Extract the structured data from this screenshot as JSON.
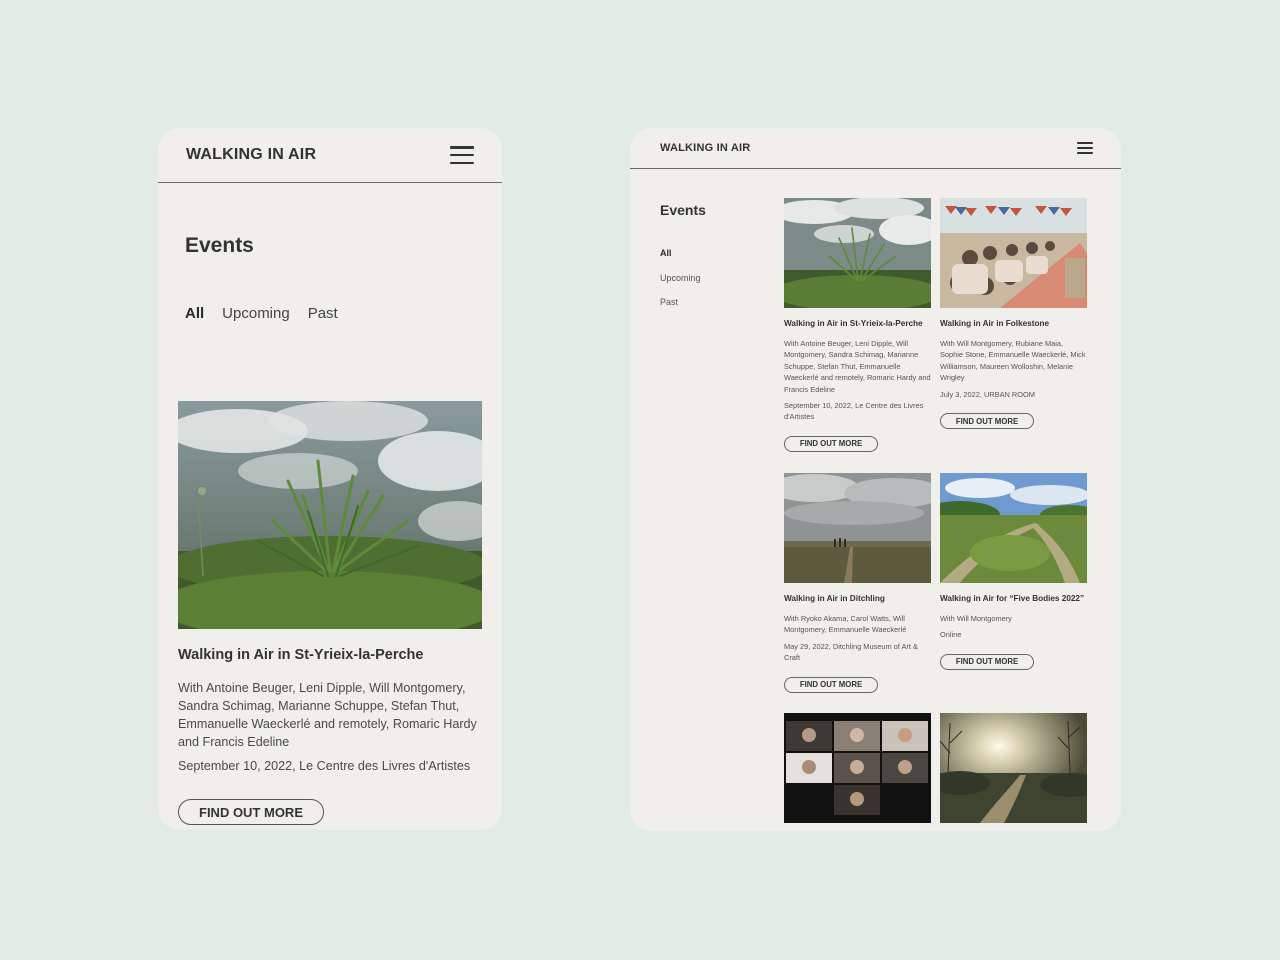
{
  "brand": "WALKING IN AIR",
  "events_title": "Events",
  "filters": {
    "all": "All",
    "upcoming": "Upcoming",
    "past": "Past"
  },
  "cta_label": "FIND OUT MORE",
  "events": [
    {
      "title": "Walking in Air in St-Yrieix-la-Perche",
      "with": "With Antoine Beuger, Leni Dipple, Will Montgomery, Sandra Schimag, Marianne Schuppe, Stefan Thut, Emmanuelle Waeckerlé and remotely, Romaric Hardy and Francis Edeline",
      "meta": "September 10, 2022, Le Centre des Livres d'Artistes"
    },
    {
      "title": "Walking in Air in Folkestone",
      "with": "With Will Montgomery, Rubiane Maia, Sophie Stone, Emmanuelle Waeckerlé, Mick Williamson, Maureen Wolloshin, Melanie Wrigley",
      "meta": "July 3, 2022, URBAN ROOM"
    },
    {
      "title": "Walking in Air in Ditchling",
      "with": "With Ryoko Akama, Carol Watts, Will Montgomery, Emmanuelle Waeckerlé",
      "meta": "May 29, 2022, Ditchling Museum of Art & Craft"
    },
    {
      "title": "Walking in Air for “Five Bodies 2022”",
      "with": "With Will Montgomery",
      "meta": "Online"
    }
  ]
}
